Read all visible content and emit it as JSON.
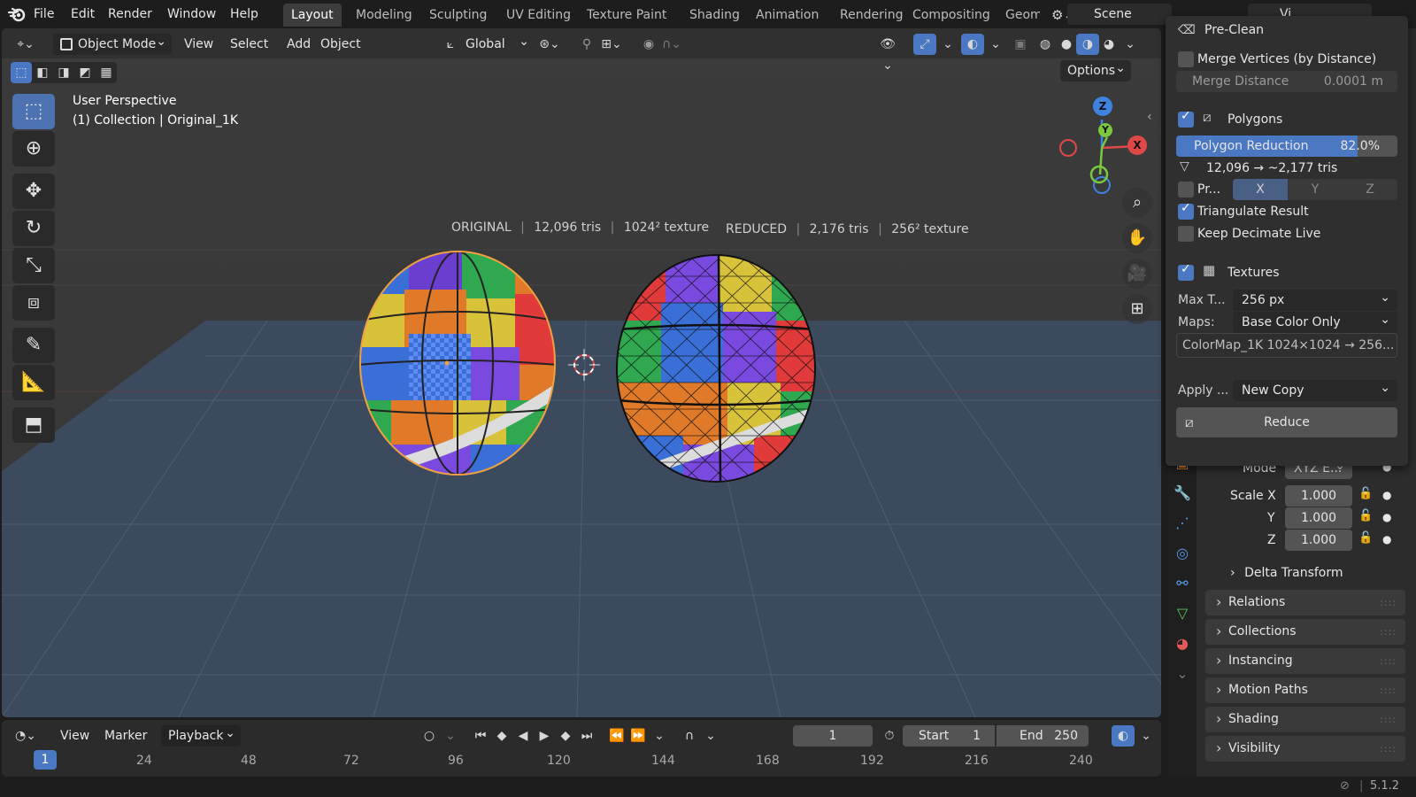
{
  "menus": {
    "file": "File",
    "edit": "Edit",
    "render": "Render",
    "window": "Window",
    "help": "Help"
  },
  "workspaces": [
    "Layout",
    "Modeling",
    "Sculpting",
    "UV Editing",
    "Texture Paint",
    "Shading",
    "Animation",
    "Rendering",
    "Compositing",
    "Geom"
  ],
  "scene": "Scene",
  "view_layer_partial": "Vi",
  "viewport_header": {
    "mode": "Object Mode",
    "view": "View",
    "select": "Select",
    "add": "Add",
    "object": "Object",
    "orientation": "Global",
    "options": "Options"
  },
  "viewport_info": {
    "perspective": "User Perspective",
    "collection": "(1) Collection | Original_1K"
  },
  "stats": {
    "original": "ORIGINAL",
    "original_tris": "12,096 tris",
    "original_tex": "1024² texture",
    "reduced": "REDUCED",
    "reduced_tris": "2,176 tris",
    "reduced_tex": "256² texture",
    "sep": "|"
  },
  "gizmo": {
    "z": "Z",
    "y": "Y",
    "x": "X"
  },
  "panel": {
    "pre_clean": "Pre-Clean",
    "merge_vertices": "Merge Vertices (by Distance)",
    "merge_distance_label": "Merge Distance",
    "merge_distance_value": "0.0001 m",
    "polygons": "Polygons",
    "polygon_reduction_label": "Polygon Reduction",
    "polygon_reduction_value": "82.0%",
    "polygon_reduction_fraction": 0.82,
    "tris_estimate": "12,096 → ~2,177 tris",
    "preserve_label": "Pr...",
    "axis_x": "X",
    "axis_y": "Y",
    "axis_z": "Z",
    "triangulate": "Triangulate Result",
    "keep_decimate": "Keep Decimate Live",
    "textures": "Textures",
    "max_tex_label": "Max T...",
    "max_tex_value": "256 px",
    "maps_label": "Maps:",
    "maps_value": "Base Color Only",
    "texture_info": "ColorMap_1K  1024×1024 → 256...",
    "apply_label": "Apply ...",
    "apply_value": "New Copy",
    "reduce_button": "Reduce"
  },
  "properties": {
    "mode_label": "Mode",
    "mode_value": "XYZ E...",
    "scale_x_label": "Scale X",
    "scale_x": "1.000",
    "scale_y_label": "Y",
    "scale_y": "1.000",
    "scale_z_label": "Z",
    "scale_z": "1.000",
    "delta_transform": "Delta Transform",
    "sections": [
      "Relations",
      "Collections",
      "Instancing",
      "Motion Paths",
      "Shading",
      "Visibility"
    ],
    "grip": "::::"
  },
  "timeline": {
    "view": "View",
    "marker": "Marker",
    "playback": "Playback",
    "current_frame": "1",
    "start_label": "Start",
    "start_value": "1",
    "end_label": "End",
    "end_value": "250",
    "ticks": [
      "1",
      "24",
      "48",
      "72",
      "96",
      "120",
      "144",
      "168",
      "192",
      "216",
      "240"
    ]
  },
  "status": {
    "version": "5.1.2"
  },
  "colors": {
    "accent": "#4a78c2",
    "header_bg": "#303030",
    "panel_bg": "#2f2f2f",
    "viewport_bg": "#393939",
    "floor": "#3a4a5e"
  }
}
